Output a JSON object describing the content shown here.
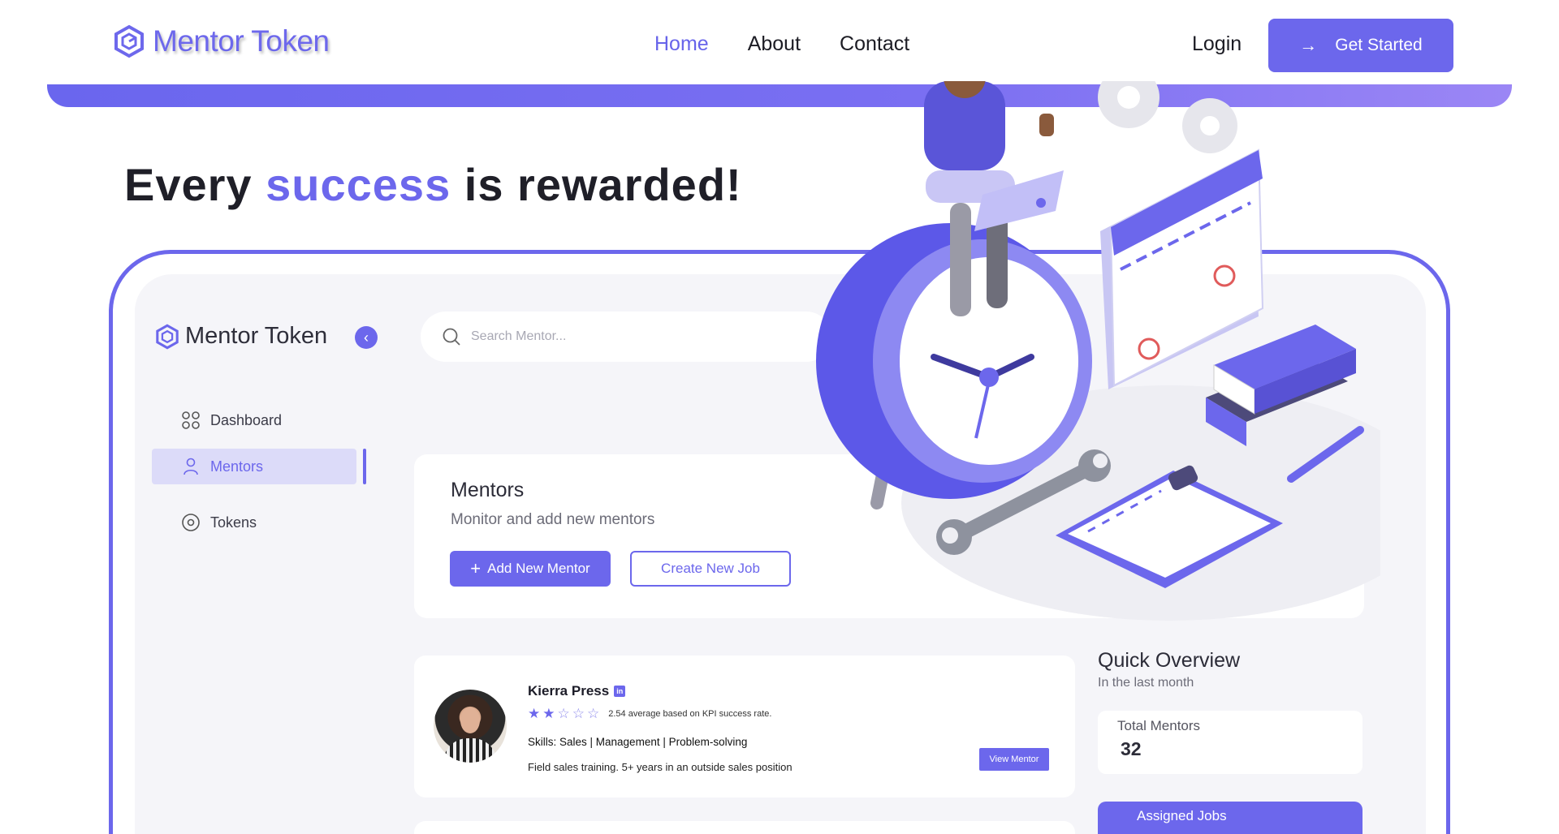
{
  "brand": {
    "name": "Mentor Token"
  },
  "nav": {
    "links": [
      {
        "label": "Home",
        "active": true
      },
      {
        "label": "About",
        "active": false
      },
      {
        "label": "Contact",
        "active": false
      }
    ],
    "login": "Login",
    "cta": "Get Started"
  },
  "hero": {
    "before": "Every ",
    "accent": "success",
    "after": " is rewarded!"
  },
  "dashboard": {
    "brand": "Mentor Token",
    "search_placeholder": "Search Mentor...",
    "sidebar": [
      {
        "label": "Dashboard",
        "icon": "grid-icon",
        "active": false
      },
      {
        "label": "Mentors",
        "icon": "user-icon",
        "active": true
      },
      {
        "label": "Tokens",
        "icon": "target-icon",
        "active": false
      }
    ],
    "mentors": {
      "title": "Mentors",
      "subtitle": "Monitor and add new mentors",
      "add_button": "Add New Mentor",
      "job_button": "Create New Job"
    },
    "mentor_item": {
      "name": "Kierra Press",
      "linkedin": "in",
      "rating_stars": 2,
      "rating_text": "2.54 average based on KPI success rate.",
      "skills": "Skills: Sales | Management | Problem-solving",
      "description": "Field sales training. 5+ years in an outside sales position",
      "view_button": "View Mentor"
    },
    "quick_overview": {
      "title": "Quick Overview",
      "subtitle": "In the last month",
      "total_mentors_label": "Total Mentors",
      "total_mentors_value": "32",
      "assigned_jobs_label": "Assigned Jobs"
    }
  },
  "colors": {
    "accent": "#6c67ec",
    "background": "#f5f5f9"
  }
}
